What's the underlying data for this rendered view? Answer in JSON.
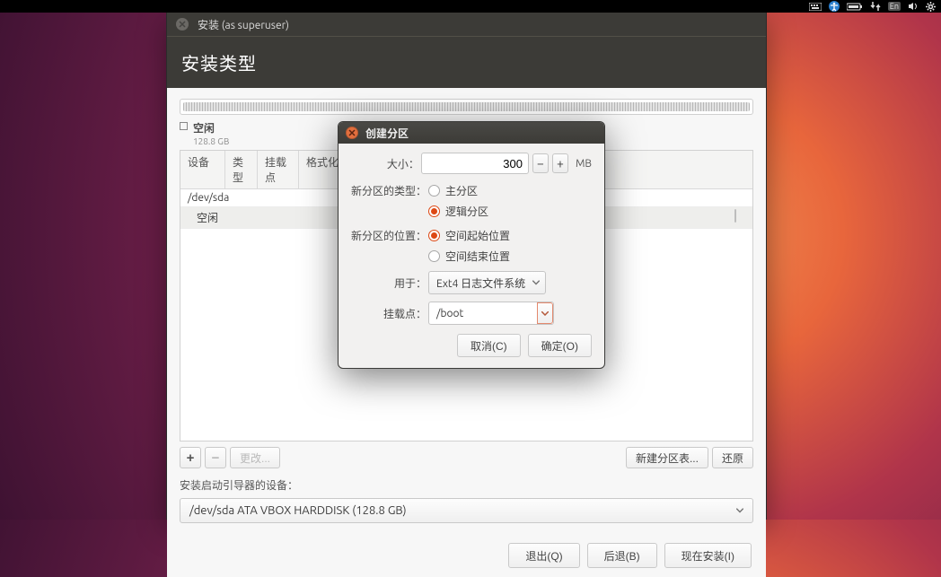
{
  "topbar": {
    "lang": "En"
  },
  "window": {
    "title": "安装 (as superuser)",
    "heading": "安装类型"
  },
  "disk": {
    "free_label": "空闲",
    "free_size": "128.8 GB"
  },
  "table": {
    "headers": {
      "device": "设备",
      "type": "类型",
      "mount": "挂载点",
      "format": "格式化"
    },
    "rows": {
      "device": "/dev/sda",
      "free": "空闲"
    }
  },
  "toolbar": {
    "plus": "+",
    "minus": "−",
    "change": "更改...",
    "new_table": "新建分区表...",
    "revert": "还原"
  },
  "boot": {
    "label": "安装启动引导器的设备：",
    "value": "/dev/sda ATA VBOX HARDDISK (128.8 GB)"
  },
  "footer": {
    "quit": "退出(Q)",
    "back": "后退(B)",
    "install": "现在安装(I)"
  },
  "dialog": {
    "title": "创建分区",
    "size_label": "大小：",
    "size_value": "300",
    "size_unit": "MB",
    "spin_minus": "−",
    "spin_plus": "+",
    "type_label": "新分区的类型：",
    "type_primary": "主分区",
    "type_logical": "逻辑分区",
    "loc_label": "新分区的位置：",
    "loc_begin": "空间起始位置",
    "loc_end": "空间结束位置",
    "use_label": "用于：",
    "use_value": "Ext4 日志文件系统",
    "mount_label": "挂载点：",
    "mount_value": "/boot",
    "cancel": "取消(C)",
    "ok": "确定(O)"
  }
}
